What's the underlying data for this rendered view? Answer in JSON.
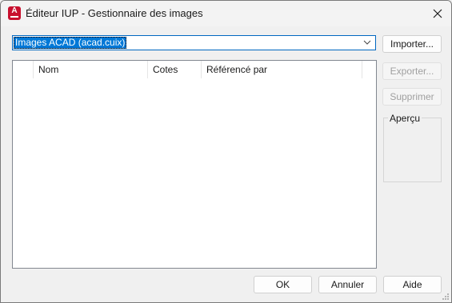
{
  "window": {
    "title": "Éditeur IUP - Gestionnaire des images",
    "icon": "autocad-app-icon",
    "icon_letter": "A"
  },
  "image_source": {
    "selected": "Images ACAD (acad.cuix)"
  },
  "image_list": {
    "columns": [
      "",
      "Nom",
      "Cotes",
      "Référencé par"
    ],
    "rows": []
  },
  "side_buttons": {
    "import_label": "Importer...",
    "export_label": "Exporter...",
    "delete_label": "Supprimer"
  },
  "preview": {
    "label": "Aperçu"
  },
  "footer": {
    "ok_label": "OK",
    "cancel_label": "Annuler",
    "help_label": "Aide"
  },
  "colors": {
    "accent": "#0078d7",
    "app_icon": "#c8102e",
    "disabled_text": "#a0a0a0"
  }
}
